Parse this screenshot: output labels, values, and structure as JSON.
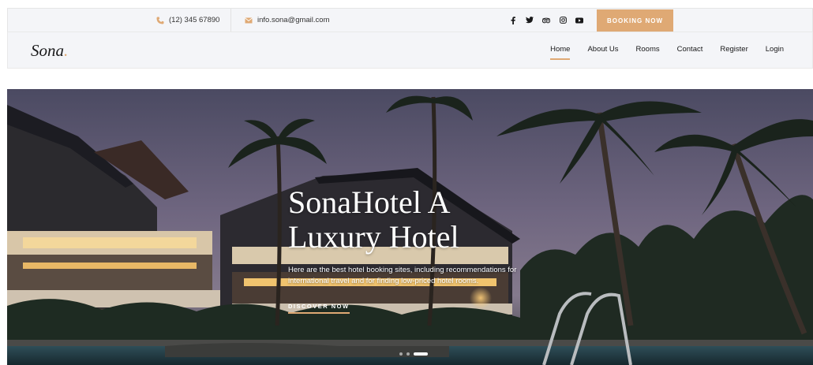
{
  "topbar": {
    "phone": "(12) 345 67890",
    "email": "info.sona@gmail.com",
    "socials": [
      "facebook-icon",
      "twitter-icon",
      "tripadvisor-icon",
      "instagram-icon",
      "youtube-icon"
    ],
    "booking_label": "BOOKING NOW"
  },
  "nav": {
    "logo_text": "Sona",
    "logo_dot": ".",
    "items": [
      {
        "label": "Home",
        "active": true
      },
      {
        "label": "About Us",
        "active": false
      },
      {
        "label": "Rooms",
        "active": false
      },
      {
        "label": "Contact",
        "active": false
      },
      {
        "label": "Register",
        "active": false
      },
      {
        "label": "Login",
        "active": false
      }
    ]
  },
  "hero": {
    "title": "SonaHotel A Luxury Hotel",
    "subtitle": "Here are the best hotel booking sites, including recommendations for international travel and for finding low-priced hotel rooms.",
    "cta_label": "DISCOVER NOW",
    "slides": 3,
    "active_slide": 2
  },
  "colors": {
    "accent": "#dfa974",
    "bar_bg": "#f4f5f8",
    "text": "#19191a"
  }
}
